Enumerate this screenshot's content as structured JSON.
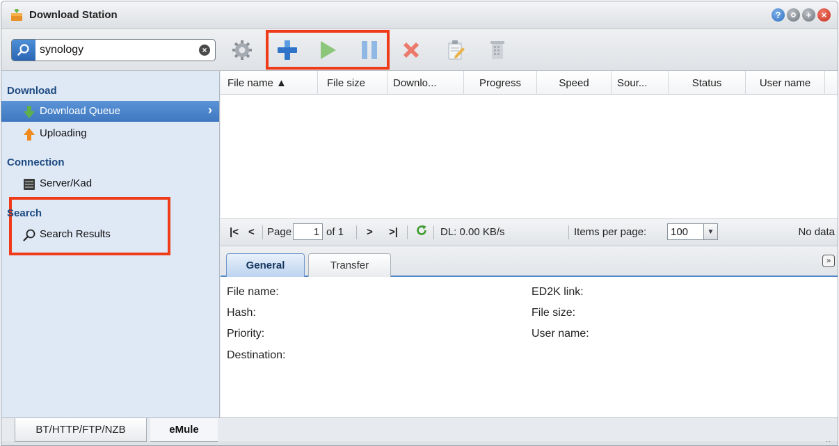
{
  "window": {
    "title": "Download Station",
    "buttons": [
      "help",
      "minimize",
      "maximize",
      "close"
    ]
  },
  "toolbar": {
    "search_value": "synology",
    "icons": [
      "settings-gear-icon",
      "add-plus-icon",
      "resume-play-icon",
      "pause-icon",
      "delete-x-icon",
      "edit-notepad-icon",
      "clear-trashcan-icon"
    ]
  },
  "sidebar": {
    "sections": [
      {
        "title": "Download",
        "items": [
          {
            "label": "Download Queue",
            "icon": "down-arrow-icon",
            "selected": true
          },
          {
            "label": "Uploading",
            "icon": "up-arrow-icon",
            "selected": false
          }
        ]
      },
      {
        "title": "Connection",
        "items": [
          {
            "label": "Server/Kad",
            "icon": "server-icon",
            "selected": false
          }
        ]
      },
      {
        "title": "Search",
        "items": [
          {
            "label": "Search Results",
            "icon": "magnifier-icon",
            "selected": false
          }
        ]
      }
    ]
  },
  "grid": {
    "columns": [
      "File name ▲",
      "File size",
      "Downlo...",
      "Progress",
      "Speed",
      "Sour...",
      "Status",
      "User name"
    ]
  },
  "pager": {
    "page_label": "Page",
    "page_value": "1",
    "of_label": "of 1",
    "dl_speed": "DL: 0.00 KB/s",
    "items_per_page_label": "Items per page:",
    "items_per_page_value": "100",
    "status_text": "No data"
  },
  "detail": {
    "tabs": [
      "General",
      "Transfer"
    ],
    "left_fields": [
      "File name:",
      "Hash:",
      "Priority:",
      "Destination:"
    ],
    "right_fields": [
      "ED2K link:",
      "File size:",
      "User name:"
    ]
  },
  "bottom_tabs": [
    "BT/HTTP/FTP/NZB",
    "eMule"
  ],
  "colors": {
    "accent": "#3f78c0",
    "highlight": "#ef3b1a",
    "sidebar_bg": "#dfe8f5"
  }
}
